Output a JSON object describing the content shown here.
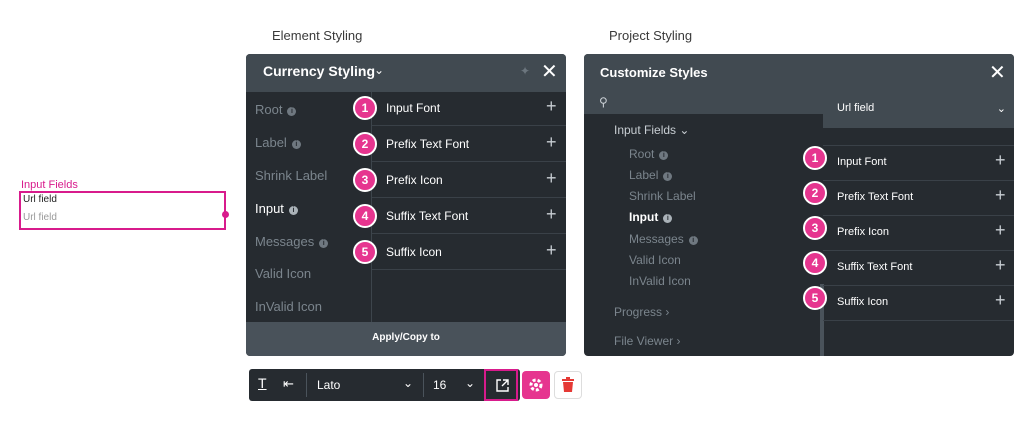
{
  "captions": {
    "element": "Element Styling",
    "project": "Project Styling"
  },
  "preview": {
    "section_label": "Input Fields",
    "field_label": "Url field",
    "placeholder": "Url field"
  },
  "currency": {
    "title": "Currency Styling",
    "nav": [
      "Root",
      "Label",
      "Shrink Label",
      "Input",
      "Messages",
      "Valid Icon",
      "InValid Icon"
    ],
    "active_nav": "Input",
    "rows": [
      {
        "num": "1",
        "label": "Input Font"
      },
      {
        "num": "2",
        "label": "Prefix Text Font"
      },
      {
        "num": "3",
        "label": "Prefix Icon"
      },
      {
        "num": "4",
        "label": "Suffix Text Font"
      },
      {
        "num": "5",
        "label": "Suffix Icon"
      }
    ],
    "footer": "Apply/Copy to"
  },
  "customize": {
    "title": "Customize Styles",
    "selected": "Url field",
    "tree": {
      "parent": "Input Fields",
      "children": [
        "Root",
        "Label",
        "Shrink Label",
        "Input",
        "Messages",
        "Valid Icon",
        "InValid Icon"
      ],
      "active": "Input",
      "after": [
        "Progress",
        "File Viewer"
      ]
    },
    "rows": [
      {
        "num": "1",
        "label": "Input Font"
      },
      {
        "num": "2",
        "label": "Prefix Text Font"
      },
      {
        "num": "3",
        "label": "Prefix Icon"
      },
      {
        "num": "4",
        "label": "Suffix Text Font"
      },
      {
        "num": "5",
        "label": "Suffix Icon"
      }
    ]
  },
  "toolbar": {
    "font": "Lato",
    "size": "16"
  },
  "colors": {
    "accent": "#e6358f",
    "panel": "#262b30",
    "header": "#414a51"
  },
  "icons": [
    "text-color-icon",
    "indent-icon",
    "chevron-down-icon",
    "external-link-icon",
    "gear-icon",
    "trash-icon",
    "search-icon",
    "close-icon",
    "pin-icon",
    "plus-icon",
    "info-icon"
  ]
}
